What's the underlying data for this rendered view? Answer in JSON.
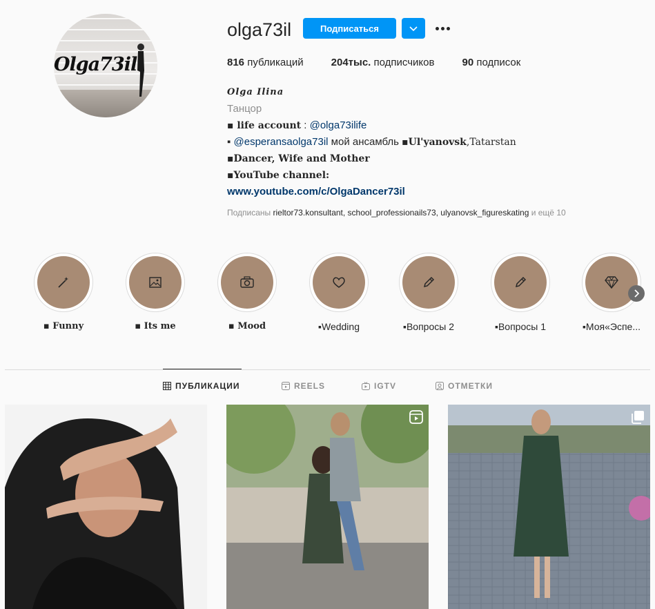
{
  "profile": {
    "avatar_text": "Olga73il",
    "username": "olga73il",
    "follow_label": "Подписаться",
    "stats": [
      {
        "count": "816",
        "label": "публикаций"
      },
      {
        "count": "204тыс.",
        "label": "подписчиков"
      },
      {
        "count": "90",
        "label": "подписок"
      }
    ],
    "full_name": "Olga Ilina",
    "category": "Танцор",
    "bio": {
      "line1_bold": "▪ life account",
      "line1_sep": " : ",
      "line1_link": "@olga73ilife",
      "line2_prefix": "▪ ",
      "line2_link": "@esperansaolga73il",
      "line2_text": " мой ансамбль ",
      "line2_bold": "▪Ul'yanovsk",
      "line2_tail": ",Tatarstan",
      "line3": "▪Dancer, Wife and Mother",
      "line4": "▪YouTube channel:",
      "website": "www.youtube.com/c/OlgaDancer73il"
    },
    "followed_by_prefix": "Подписаны ",
    "followed_by_names": "rieltor73.konsultant, school_professionails73, ulyanovsk_figureskating",
    "followed_by_more": " и ещё 10"
  },
  "highlights": [
    {
      "label": "▪ Funny",
      "icon": "magic-wand-icon"
    },
    {
      "label": "▪ Its me",
      "icon": "image-icon"
    },
    {
      "label": "▪ Mood",
      "icon": "camera-icon"
    },
    {
      "label": "▪Wedding",
      "icon": "heart-icon"
    },
    {
      "label": "▪Вопросы 2",
      "icon": "pencil-icon"
    },
    {
      "label": "▪Вопросы 1",
      "icon": "pencil-icon"
    },
    {
      "label": "▪Моя«Эспе...",
      "icon": "diamond-icon"
    }
  ],
  "tabs": [
    {
      "label": "ПУБЛИКАЦИИ",
      "icon": "grid-icon",
      "active": true
    },
    {
      "label": "REELS",
      "icon": "reels-icon",
      "active": false
    },
    {
      "label": "IGTV",
      "icon": "igtv-icon",
      "active": false
    },
    {
      "label": "ОТМЕТКИ",
      "icon": "tagged-icon",
      "active": false
    }
  ],
  "colors": {
    "accent": "#0095f6",
    "highlight_bg": "#a88b74",
    "link": "#00376b",
    "muted": "#8e8e8e"
  }
}
